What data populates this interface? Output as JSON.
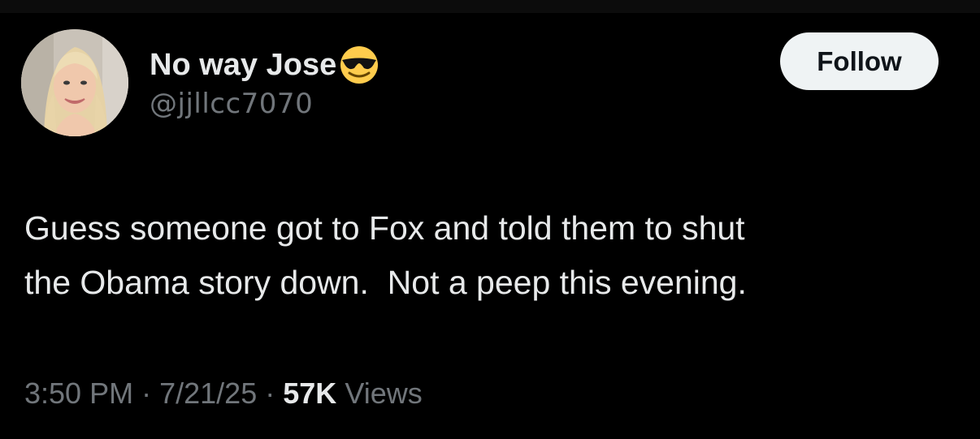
{
  "tweet": {
    "author": {
      "display_name": "No way Jose",
      "emoji": "smiling-face-with-sunglasses",
      "handle": "@jjllcc7070"
    },
    "follow_label": "Follow",
    "text": "Guess someone got to Fox and told them to shut\nthe Obama story down.  Not a peep this evening.",
    "time": "3:50 PM",
    "separator": "·",
    "date": "7/21/25",
    "views_count": "57K",
    "views_label": "Views"
  },
  "colors": {
    "background": "#000000",
    "primary_text": "#e7e9ea",
    "secondary_text": "#71767b",
    "follow_button_bg": "#eff3f4",
    "follow_button_text": "#0f1419"
  }
}
